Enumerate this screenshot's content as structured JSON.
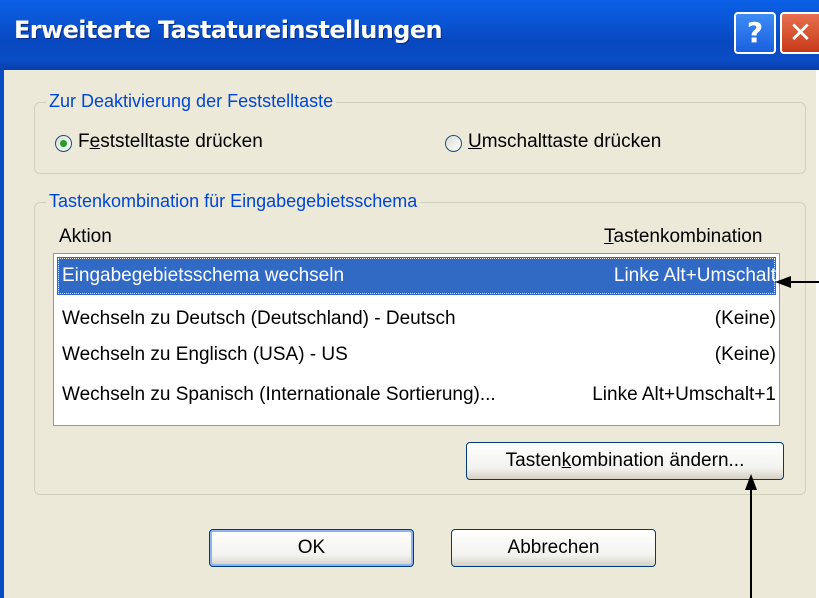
{
  "window": {
    "title": "Erweiterte Tastatureinstellungen",
    "help_glyph": "?",
    "close_glyph": "✕"
  },
  "caps_group": {
    "legend": "Zur Deaktivierung der Feststelltaste",
    "option1": {
      "label_pre": "F",
      "label_ul": "e",
      "label_post": "ststelltaste drücken",
      "selected": true
    },
    "option2": {
      "label_pre": "",
      "label_ul": "U",
      "label_post": "mschalttaste drücken",
      "selected": false
    }
  },
  "hotkey_group": {
    "legend": "Tastenkombination für Eingabegebietsschema",
    "col_action": "Aktion",
    "col_combo_ul": "T",
    "col_combo_rest": "astenkombination",
    "rows": [
      {
        "action": "Eingabegebietsschema wechseln",
        "combo": "Linke Alt+Umschalt",
        "selected": true
      },
      {
        "action": "Wechseln zu Deutsch (Deutschland) - Deutsch",
        "combo": "(Keine)",
        "selected": false
      },
      {
        "action": "Wechseln zu Englisch (USA) - US",
        "combo": "(Keine)",
        "selected": false
      },
      {
        "action": "Wechseln zu Spanisch (Internationale Sortierung)...",
        "combo": "Linke Alt+Umschalt+1",
        "selected": false
      }
    ],
    "change_button": {
      "pre": "Tasten",
      "ul": "k",
      "post": "ombination ändern..."
    }
  },
  "buttons": {
    "ok": "OK",
    "cancel": "Abbrechen"
  }
}
